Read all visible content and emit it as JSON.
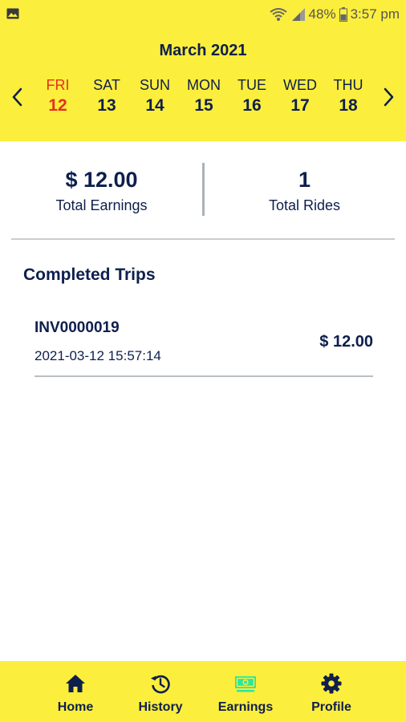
{
  "status_bar": {
    "battery": "48%",
    "time": "3:57 pm"
  },
  "calendar": {
    "month": "March 2021",
    "days": [
      {
        "name": "FRI",
        "date": "12",
        "active": true
      },
      {
        "name": "SAT",
        "date": "13",
        "active": false
      },
      {
        "name": "SUN",
        "date": "14",
        "active": false
      },
      {
        "name": "MON",
        "date": "15",
        "active": false
      },
      {
        "name": "TUE",
        "date": "16",
        "active": false
      },
      {
        "name": "WED",
        "date": "17",
        "active": false
      },
      {
        "name": "THU",
        "date": "18",
        "active": false
      }
    ]
  },
  "summary": {
    "earnings_value": "$ 12.00",
    "earnings_label": "Total Earnings",
    "rides_value": "1",
    "rides_label": "Total Rides"
  },
  "trips": {
    "title": "Completed Trips",
    "items": [
      {
        "id": "INV0000019",
        "datetime": "2021-03-12 15:57:14",
        "amount": "$ 12.00"
      }
    ]
  },
  "bottom_nav": {
    "items": [
      {
        "label": "Home",
        "icon": "home-icon",
        "active": false
      },
      {
        "label": "History",
        "icon": "history-icon",
        "active": false
      },
      {
        "label": "Earnings",
        "icon": "earnings-icon",
        "active": true
      },
      {
        "label": "Profile",
        "icon": "gear-icon",
        "active": false
      }
    ]
  },
  "colors": {
    "header_bg": "#fcee3c",
    "primary_text": "#0e1f4d",
    "active_day": "#e4311f",
    "active_nav_icon": "#2ee59d"
  }
}
